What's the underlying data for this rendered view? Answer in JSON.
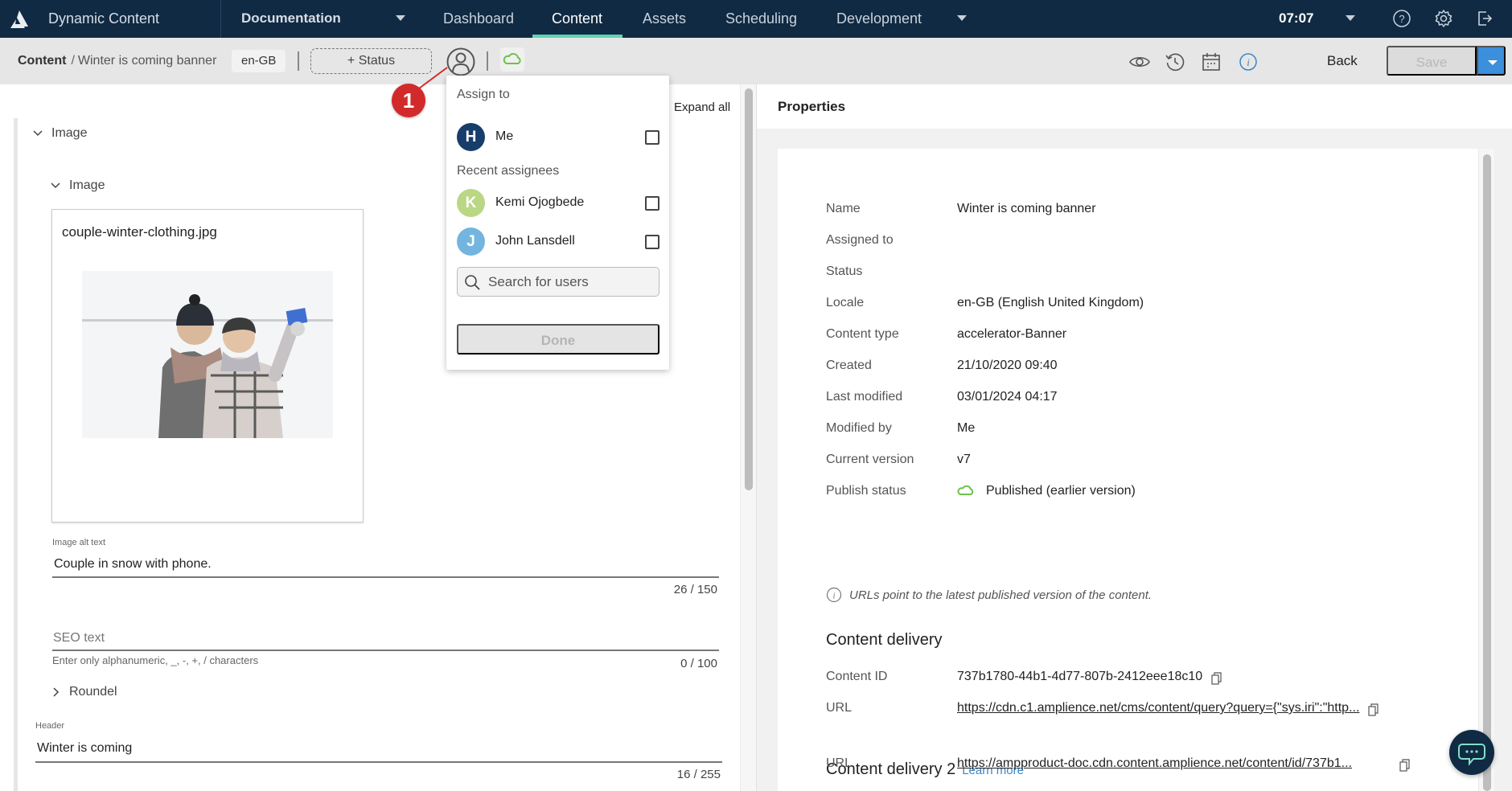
{
  "topnav": {
    "app_title": "Dynamic Content",
    "hub": "Documentation",
    "tabs": [
      {
        "label": "Dashboard",
        "active": false
      },
      {
        "label": "Content",
        "active": true
      },
      {
        "label": "Assets",
        "active": false
      },
      {
        "label": "Scheduling",
        "active": false
      },
      {
        "label": "Development",
        "active": false
      }
    ],
    "clock": "07:07",
    "icons": [
      "help-icon",
      "settings-icon",
      "logout-icon"
    ],
    "accent_color": "#5fd3b3",
    "bg_color": "#102a43"
  },
  "toolbar": {
    "breadcrumb_root": "Content",
    "breadcrumb_separator": "/",
    "breadcrumb_item": "Winter is coming banner",
    "locale": "en-GB",
    "status_button": "+ Status",
    "icons": [
      "preview-icon",
      "history-icon",
      "schedule-icon",
      "info-icon"
    ],
    "back_label": "Back",
    "save_label": "Save",
    "save_accent": "#3b8fdc"
  },
  "left": {
    "expand_all": "Expand all",
    "section_image": "Image",
    "subsection_image": "Image",
    "image_filename": "couple-winter-clothing.jpg",
    "alt_text_label": "Image alt text",
    "alt_text_value": "Couple in snow with phone.",
    "alt_text_counter": "26 / 150",
    "seo_placeholder": "SEO text",
    "seo_hint": "Enter only alphanumeric, _, -, +, / characters",
    "seo_counter": "0 / 100",
    "roundel": "Roundel",
    "header_label": "Header",
    "header_value": "Winter is coming",
    "header_counter": "16 / 255"
  },
  "assign_dropdown": {
    "title": "Assign to",
    "me": {
      "initial": "H",
      "name": "Me",
      "color": "#173d6b",
      "checked": false
    },
    "recent_title": "Recent assignees",
    "recent": [
      {
        "initial": "K",
        "name": "Kemi Ojogbede",
        "color": "#b9d784",
        "checked": false
      },
      {
        "initial": "J",
        "name": "John Lansdell",
        "color": "#73b5de",
        "checked": false
      }
    ],
    "search_placeholder": "Search for users",
    "done_label": "Done"
  },
  "annotation": {
    "number": "1",
    "color": "#d22a2a"
  },
  "properties": {
    "title": "Properties",
    "rows": [
      {
        "key": "Name",
        "value": "Winter is coming banner"
      },
      {
        "key": "Assigned to",
        "value": ""
      },
      {
        "key": "Status",
        "value": ""
      },
      {
        "key": "Locale",
        "value": "en-GB (English United Kingdom)"
      },
      {
        "key": "Content type",
        "value": "accelerator-Banner"
      },
      {
        "key": "Created",
        "value": "21/10/2020 09:40"
      },
      {
        "key": "Last modified",
        "value": "03/01/2024 04:17"
      },
      {
        "key": "Modified by",
        "value": "Me"
      },
      {
        "key": "Current version",
        "value": "v7"
      },
      {
        "key": "Publish status",
        "value": "Published (earlier version)"
      }
    ],
    "publish_color": "#6cc24a",
    "note": "URLs point to the latest published version of the content.",
    "delivery_title": "Content delivery",
    "content_id_label": "Content ID",
    "content_id": "737b1780-44b1-4d77-807b-2412eee18c10",
    "url_label": "URL",
    "url": "https://cdn.c1.amplience.net/cms/content/query?query={\"sys.iri\":\"http...",
    "delivery2_title": "Content delivery 2",
    "learn_more": "Learn more",
    "url2_label": "URL",
    "url2": "https://ampproduct-doc.cdn.content.amplience.net/content/id/737b1..."
  }
}
